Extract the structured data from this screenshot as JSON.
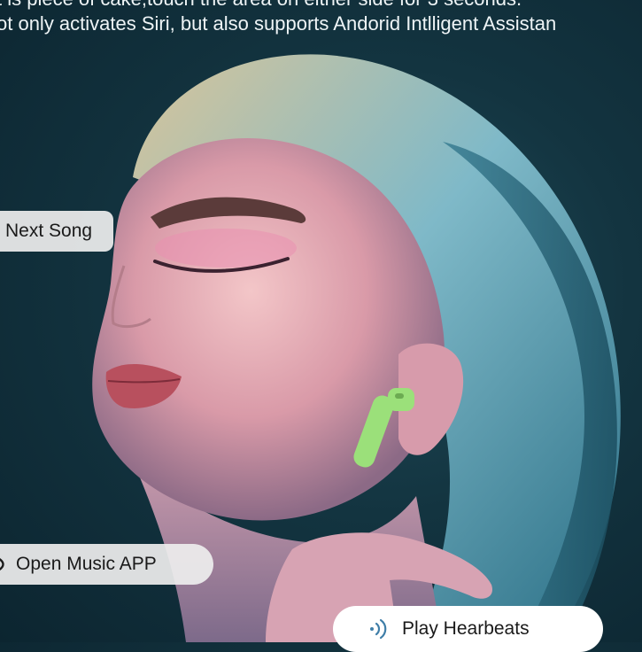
{
  "caption": {
    "line1": "t is piece of cake,touch the area on either side for 3 seconds.",
    "line2": "ot only activates Siri, but also supports Andorid Intlligent Assistan"
  },
  "labels": {
    "next_song": "Next Song",
    "open_music_app": "Open Music APP",
    "play_heartbeats": "Play Hearbeats"
  },
  "icons": {
    "sound_wave": "sound-wave-icon"
  },
  "colors": {
    "earbud": "#9be07a",
    "background": "#133440",
    "label_bg": "#eeeeee"
  }
}
